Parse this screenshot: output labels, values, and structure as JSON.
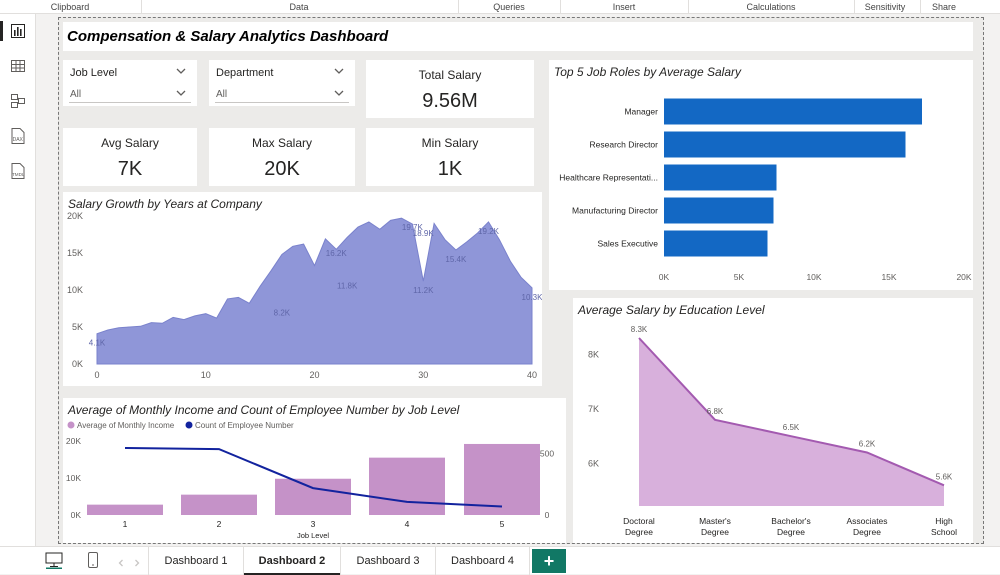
{
  "ribbon": [
    "Clipboard",
    "Data",
    "Queries",
    "Insert",
    "Calculations",
    "Sensitivity",
    "Share"
  ],
  "leftbar": [
    {
      "icon": "report-view-icon"
    },
    {
      "icon": "table-view-icon"
    },
    {
      "icon": "model-view-icon"
    },
    {
      "icon": "dax-query-view-icon",
      "tag": "DAX"
    },
    {
      "icon": "tmdl-view-icon",
      "tag": "TMDL"
    }
  ],
  "dashboard": {
    "title": "Compensation & Salary Analytics Dashboard",
    "slicers": [
      {
        "label": "Job Level",
        "value": "All"
      },
      {
        "label": "Department",
        "value": "All"
      }
    ],
    "kpis": {
      "total_salary": {
        "label": "Total Salary",
        "value": "9.56M"
      },
      "avg_salary": {
        "label": "Avg Salary",
        "value": "7K"
      },
      "max_salary": {
        "label": "Max Salary",
        "value": "20K"
      },
      "min_salary": {
        "label": "Min Salary",
        "value": "1K"
      }
    }
  },
  "colors": {
    "area_fill": "#8f96d8",
    "bar_blue": "#1368c4",
    "edu_fill": "#d8b0dc",
    "edu_line": "#a35ab0",
    "income_bar": "#c592c8",
    "count_line": "#12239e",
    "active_tab": "#117865"
  },
  "chart_data": [
    {
      "id": "top-job-roles",
      "type": "bar",
      "orientation": "horizontal",
      "title": "Top 5 Job Roles by Average Salary",
      "categories": [
        "Manager",
        "Research Director",
        "Healthcare Representati...",
        "Manufacturing Director",
        "Sales Executive"
      ],
      "values": [
        17200,
        16100,
        7500,
        7300,
        6900
      ],
      "xlim": [
        0,
        20000
      ],
      "xticks": [
        "0K",
        "5K",
        "10K",
        "15K",
        "20K"
      ]
    },
    {
      "id": "salary-growth",
      "type": "area",
      "title": "Salary Growth by Years at Company",
      "x": [
        0,
        1,
        2,
        3,
        4,
        5,
        6,
        7,
        8,
        9,
        10,
        11,
        12,
        13,
        14,
        15,
        16,
        17,
        18,
        19,
        20,
        21,
        22,
        23,
        24,
        25,
        26,
        27,
        28,
        29,
        30,
        31,
        32,
        33,
        34,
        35,
        36,
        37,
        38,
        39,
        40
      ],
      "y": [
        4100,
        4600,
        4900,
        5000,
        5100,
        5600,
        5500,
        6300,
        6000,
        6500,
        6800,
        6200,
        8800,
        9000,
        8200,
        10500,
        12600,
        14800,
        15900,
        16200,
        13300,
        16900,
        15500,
        17100,
        18500,
        19200,
        18200,
        19400,
        19700,
        18900,
        11200,
        19000,
        16800,
        15400,
        16500,
        17700,
        19200,
        16800,
        13900,
        11700,
        10300
      ],
      "labels": [
        {
          "x": 0,
          "text": "4.1K"
        },
        {
          "x": 17,
          "text": "8.2K"
        },
        {
          "x": 22,
          "text": "16.2K"
        },
        {
          "x": 23,
          "text": "11.8K"
        },
        {
          "x": 29,
          "text": "19.7K"
        },
        {
          "x": 30,
          "text": "18.9K"
        },
        {
          "x": 30,
          "text": "11.2K"
        },
        {
          "x": 33,
          "text": "15.4K"
        },
        {
          "x": 36,
          "text": "19.2K"
        },
        {
          "x": 40,
          "text": "10.3K"
        }
      ],
      "ylim": [
        0,
        20000
      ],
      "yticks": [
        "0K",
        "5K",
        "10K",
        "15K",
        "20K"
      ],
      "xticks": [
        "0",
        "10",
        "20",
        "30",
        "40"
      ]
    },
    {
      "id": "salary-by-education",
      "type": "area",
      "title": "Average Salary by Education Level",
      "categories": [
        "Doctoral Degree",
        "Master's Degree",
        "Bachelor's Degree",
        "Associates Degree",
        "High School"
      ],
      "values": [
        8300,
        6800,
        6500,
        6200,
        5600
      ],
      "data_labels": [
        "8.3K",
        "6.8K",
        "6.5K",
        "6.2K",
        "5.6K"
      ],
      "yticks": [
        "6K",
        "7K",
        "8K"
      ]
    },
    {
      "id": "income-count-by-level",
      "type": "bar",
      "title": "Average of Monthly Income and Count of Employee Number by Job Level",
      "xlabel": "Job Level",
      "categories": [
        "1",
        "2",
        "3",
        "4",
        "5"
      ],
      "series": [
        {
          "name": "Average of Monthly Income",
          "type": "bar",
          "values": [
            2800,
            5500,
            9800,
            15500,
            19200
          ]
        },
        {
          "name": "Count of Employee Number",
          "type": "line",
          "values": [
            543,
            534,
            218,
            106,
            69
          ]
        }
      ],
      "yticks_left": [
        "0K",
        "10K",
        "20K"
      ],
      "yticks_right": [
        "0",
        "500"
      ]
    }
  ],
  "tabs": [
    {
      "label": "Dashboard 1",
      "active": false
    },
    {
      "label": "Dashboard 2",
      "active": true
    },
    {
      "label": "Dashboard 3",
      "active": false
    },
    {
      "label": "Dashboard 4",
      "active": false
    }
  ],
  "add_tab_label": "+"
}
